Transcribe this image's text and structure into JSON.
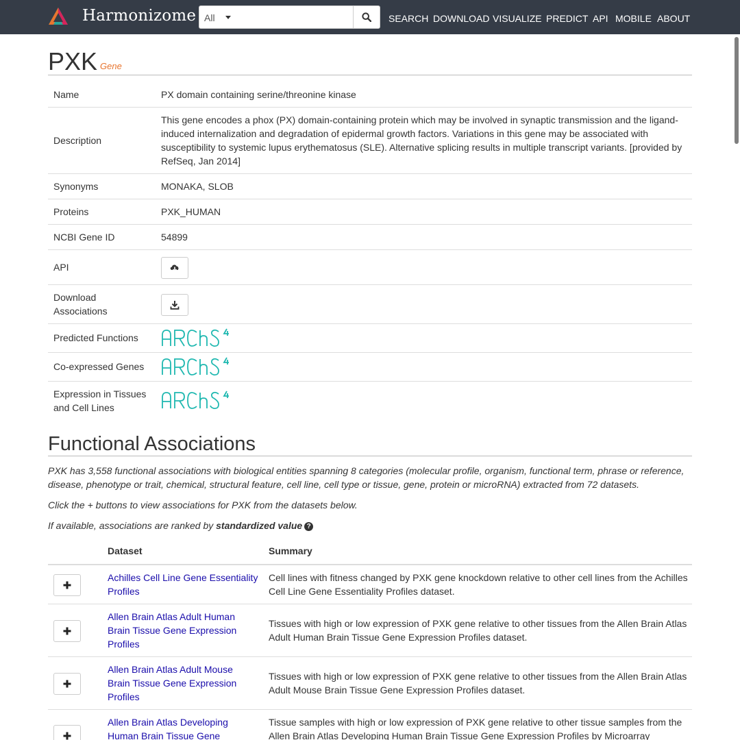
{
  "nav": {
    "brand": "Harmonizome",
    "select_value": "All",
    "search_value": "",
    "links": [
      "SEARCH",
      "DOWNLOAD",
      "VISUALIZE",
      "PREDICT",
      "API",
      "MOBILE",
      "ABOUT"
    ],
    "logo_colors": [
      "#e8752f",
      "#d6245b",
      "#26a69a"
    ]
  },
  "gene": {
    "symbol": "PXK",
    "type_label": "Gene",
    "rows": {
      "name": {
        "label": "Name",
        "value": "PX domain containing serine/threonine kinase"
      },
      "description": {
        "label": "Description",
        "value": "This gene encodes a phox (PX) domain-containing protein which may be involved in synaptic transmission and the ligand-induced internalization and degradation of epidermal growth factors. Variations in this gene may be associated with susceptibility to systemic lupus erythematosus (SLE). Alternative splicing results in multiple transcript variants. [provided by RefSeq, Jan 2014]"
      },
      "synonyms": {
        "label": "Synonyms",
        "value": "MONAKA, SLOB"
      },
      "proteins": {
        "label": "Proteins",
        "value": "PXK_HUMAN"
      },
      "ncbi": {
        "label": "NCBI Gene ID",
        "value": "54899"
      },
      "api": {
        "label": "API",
        "icon": "cloud-download-icon"
      },
      "download": {
        "label": "Download Associations",
        "icon": "download-icon"
      },
      "predicted": {
        "label": "Predicted Functions",
        "logo": "ARCHS4"
      },
      "coexpressed": {
        "label": "Co-expressed Genes",
        "logo": "ARCHS4"
      },
      "expression": {
        "label": "Expression in Tissues and Cell Lines",
        "logo": "ARCHS4"
      }
    }
  },
  "functional": {
    "heading": "Functional Associations",
    "summary": "PXK has 3,558 functional associations with biological entities spanning 8 categories (molecular profile, organism, functional term, phrase or reference, disease, phenotype or trait, chemical, structural feature, cell line, cell type or tissue, gene, protein or microRNA) extracted from 72 datasets.",
    "click_hint": "Click the + buttons to view associations for PXK from the datasets below.",
    "ranked_prefix": "If available, associations are ranked by ",
    "ranked_bold": "standardized value",
    "table": {
      "headers": {
        "dataset": "Dataset",
        "summary": "Summary"
      },
      "rows": [
        {
          "dataset": "Achilles Cell Line Gene Essentiality Profiles",
          "summary": "Cell lines with fitness changed by PXK gene knockdown relative to other cell lines from the Achilles Cell Line Gene Essentiality Profiles dataset."
        },
        {
          "dataset": "Allen Brain Atlas Adult Human Brain Tissue Gene Expression Profiles",
          "summary": "Tissues with high or low expression of PXK gene relative to other tissues from the Allen Brain Atlas Adult Human Brain Tissue Gene Expression Profiles dataset."
        },
        {
          "dataset": "Allen Brain Atlas Adult Mouse Brain Tissue Gene Expression Profiles",
          "summary": "Tissues with high or low expression of PXK gene relative to other tissues from the Allen Brain Atlas Adult Mouse Brain Tissue Gene Expression Profiles dataset."
        },
        {
          "dataset": "Allen Brain Atlas Developing Human Brain Tissue Gene",
          "summary": "Tissue samples with high or low expression of PXK gene relative to other tissue samples from the Allen Brain Atlas Developing Human Brain Tissue Gene Expression Profiles by Microarray"
        }
      ]
    }
  }
}
